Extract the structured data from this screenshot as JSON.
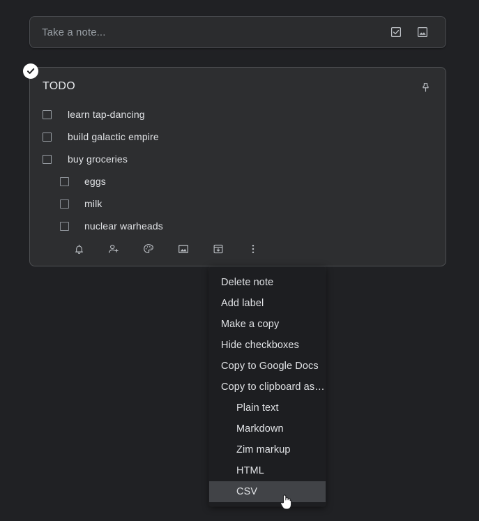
{
  "colors": {
    "page_background": "#202124",
    "card_background": "#2d2e30",
    "menu_background": "#1d1e21",
    "menu_highlight": "#414347",
    "text_primary": "#e8eaed",
    "text_placeholder": "#9aa0a6",
    "badge_background": "#ffffff"
  },
  "take_note": {
    "placeholder": "Take a note...",
    "new_list_icon": "checkbox-list-icon",
    "new_image_icon": "image-icon"
  },
  "note": {
    "selected_badge_icon": "check-circle-icon",
    "title": "TODO",
    "pin_icon": "pin-icon",
    "items": [
      {
        "label": "learn tap-dancing",
        "checked": false,
        "indent": 0
      },
      {
        "label": "build galactic empire",
        "checked": false,
        "indent": 0
      },
      {
        "label": "buy groceries",
        "checked": false,
        "indent": 0
      },
      {
        "label": "eggs",
        "checked": false,
        "indent": 1
      },
      {
        "label": "milk",
        "checked": false,
        "indent": 1
      },
      {
        "label": "nuclear warheads",
        "checked": false,
        "indent": 1
      }
    ],
    "toolbar": [
      {
        "name": "reminder-bell-icon",
        "tooltip": "Remind me"
      },
      {
        "name": "add-collaborator-icon",
        "tooltip": "Collaborator"
      },
      {
        "name": "palette-icon",
        "tooltip": "Change color"
      },
      {
        "name": "image-icon",
        "tooltip": "Add image"
      },
      {
        "name": "archive-icon",
        "tooltip": "Archive"
      },
      {
        "name": "more-options-icon",
        "tooltip": "More"
      }
    ]
  },
  "context_menu": {
    "items": [
      {
        "label": "Delete note",
        "sub": false,
        "highlighted": false
      },
      {
        "label": "Add label",
        "sub": false,
        "highlighted": false
      },
      {
        "label": "Make a copy",
        "sub": false,
        "highlighted": false
      },
      {
        "label": "Hide checkboxes",
        "sub": false,
        "highlighted": false
      },
      {
        "label": "Copy to Google Docs",
        "sub": false,
        "highlighted": false
      },
      {
        "label": "Copy to clipboard as…",
        "sub": false,
        "highlighted": false
      },
      {
        "label": "Plain text",
        "sub": true,
        "highlighted": false
      },
      {
        "label": "Markdown",
        "sub": true,
        "highlighted": false
      },
      {
        "label": "Zim markup",
        "sub": true,
        "highlighted": false
      },
      {
        "label": "HTML",
        "sub": true,
        "highlighted": false
      },
      {
        "label": "CSV",
        "sub": true,
        "highlighted": true
      }
    ]
  },
  "cursor": {
    "icon": "pointer-hand-cursor"
  }
}
